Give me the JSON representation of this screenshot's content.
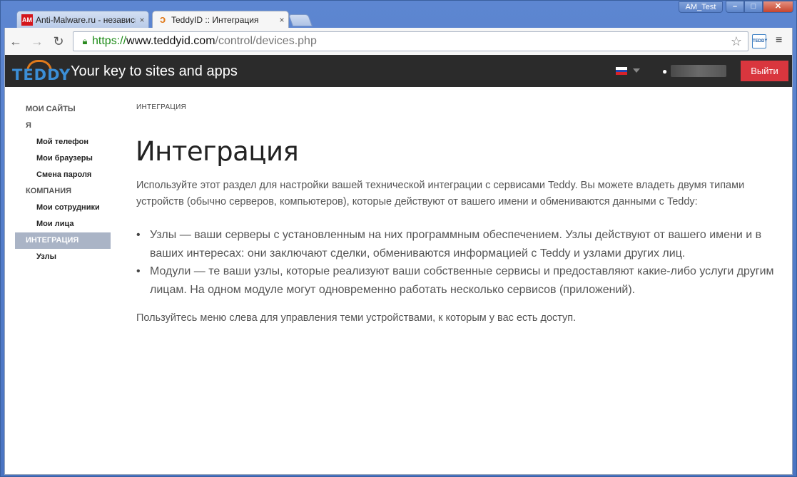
{
  "window": {
    "user_badge": "AM_Test",
    "buttons": {
      "minimize": "–",
      "maximize": "□",
      "close": "✕"
    }
  },
  "tabs": [
    {
      "favicon": "AM",
      "title": "Anti-Malware.ru - независим",
      "close": "×"
    },
    {
      "favicon": "teddy-logo",
      "title": "TeddyID :: Интеграция",
      "close": "×"
    }
  ],
  "toolbar": {
    "back": "←",
    "forward": "→",
    "reload": "↻",
    "url_scheme": "https://",
    "url_host": "www.teddyid.com",
    "url_path": "/control/devices.php",
    "bookmark_star": "☆",
    "extension": "TEDDY",
    "menu": "≡"
  },
  "site_header": {
    "logo": "TEDDY",
    "tagline": "Your key to sites and apps",
    "language": "ru",
    "logout_label": "Выйти"
  },
  "sidebar": {
    "items": [
      {
        "label": "МОИ САЙТЫ",
        "type": "section"
      },
      {
        "label": "Я",
        "type": "section"
      },
      {
        "label": "Мой телефон",
        "type": "item"
      },
      {
        "label": "Мои браузеры",
        "type": "item"
      },
      {
        "label": "Смена пароля",
        "type": "item"
      },
      {
        "label": "КОМПАНИЯ",
        "type": "section"
      },
      {
        "label": "Мои сотрудники",
        "type": "item"
      },
      {
        "label": "Мои лица",
        "type": "item"
      },
      {
        "label": "ИНТЕГРАЦИЯ",
        "type": "active"
      },
      {
        "label": "Узлы",
        "type": "item"
      }
    ]
  },
  "main": {
    "breadcrumb": "ИНТЕГРАЦИЯ",
    "title": "Интеграция",
    "intro": "Используйте этот раздел для настройки вашей технической интеграции с сервисами Teddy. Вы можете владеть двумя типами устройств (обычно серверов, компьютеров), которые действуют от вашего имени и обмениваются данными с Teddy:",
    "bullets": [
      "Узлы — ваши серверы с установленным на них программным обеспечением. Узлы действуют от вашего имени и в ваших интересах: они заключают сделки, обмениваются информацией с Teddy и узлами других лиц.",
      "Модули — те ваши узлы, которые реализуют ваши собственные сервисы и предоставляют какие-либо услуги другим лицам. На одном модуле могут одновременно работать несколько сервисов (приложений)."
    ],
    "outro": "Пользуйтесь меню слева для управления теми устройствами, к которым у вас есть доступ."
  },
  "colors": {
    "header_bg": "#2b2b2b",
    "logout_bg": "#d9363e",
    "sidebar_active_bg": "#aab4c6",
    "url_green": "#1e8c19"
  }
}
